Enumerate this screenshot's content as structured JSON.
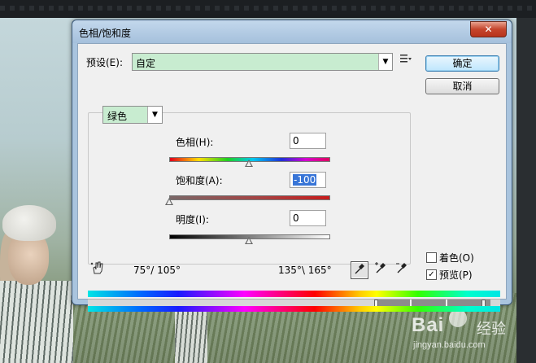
{
  "dialog": {
    "title": "色相/饱和度",
    "close_label": "✕"
  },
  "preset": {
    "label": "预设(E):",
    "value": "自定",
    "menu_icon": "preset-options-icon"
  },
  "buttons": {
    "ok": "确定",
    "cancel": "取消"
  },
  "channel": {
    "value": "绿色"
  },
  "hue": {
    "label": "色相(H):",
    "value": "0",
    "slider_fraction": 0.5
  },
  "saturation": {
    "label": "饱和度(A):",
    "value": "-100",
    "slider_fraction": 0.0
  },
  "lightness": {
    "label": "明度(I):",
    "value": "0",
    "slider_fraction": 0.5
  },
  "ranges": {
    "left": "75°/ 105°",
    "right": "135°\\ 165°"
  },
  "tools": {
    "hand": "targeted-adjustment-icon",
    "eyedropper": "eyedropper-icon",
    "eyedropper_add": "eyedropper-plus-icon",
    "eyedropper_sub": "eyedropper-minus-icon"
  },
  "options": {
    "colorize": {
      "label": "着色(O)",
      "checked": false
    },
    "preview": {
      "label": "预览(P)",
      "checked": true,
      "mark": "✓"
    }
  },
  "watermark": {
    "brand": "Bai",
    "service": "经验",
    "url": "jingyan.baidu.com"
  },
  "colors": {
    "accent_green": "#c8ecd0",
    "selection_blue": "#3875d7",
    "window_frame": "#a9c4de"
  }
}
